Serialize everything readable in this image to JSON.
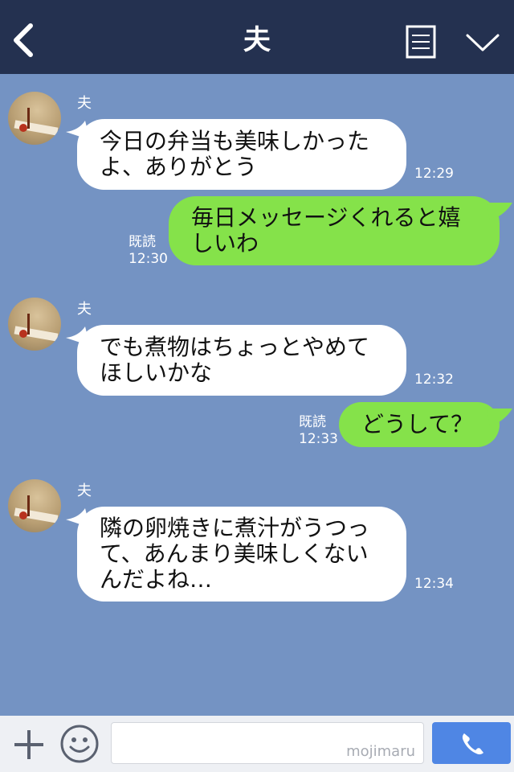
{
  "header": {
    "title": "夫"
  },
  "messages": [
    {
      "sender": "夫",
      "text": "今日の弁当も美味しかった\nよ、ありがとう",
      "time": "12:29"
    },
    {
      "text": "毎日メッセージくれると嬉\nしいわ",
      "read": "既読",
      "time": "12:30"
    },
    {
      "sender": "夫",
      "text": "でも煮物はちょっとやめて\nほしいかな",
      "time": "12:32"
    },
    {
      "text": "どうして？",
      "read": "既読",
      "time": "12:33"
    },
    {
      "sender": "夫",
      "text": "隣の卵焼きに煮汁がうつっ\nて、あんまり美味しくない\nんだよね…",
      "time": "12:34"
    }
  ],
  "footer": {
    "watermark": "mojimaru"
  },
  "colors": {
    "header": "#243150",
    "background": "#7493c3",
    "bubble_in": "#ffffff",
    "bubble_out": "#85e24a",
    "call_button": "#4f86e4"
  },
  "icons": {
    "back": "chevron-left-icon",
    "notes": "note-list-icon",
    "menu": "chevron-down-icon",
    "plus": "plus-icon",
    "emoji": "smiley-icon",
    "call": "phone-icon"
  }
}
